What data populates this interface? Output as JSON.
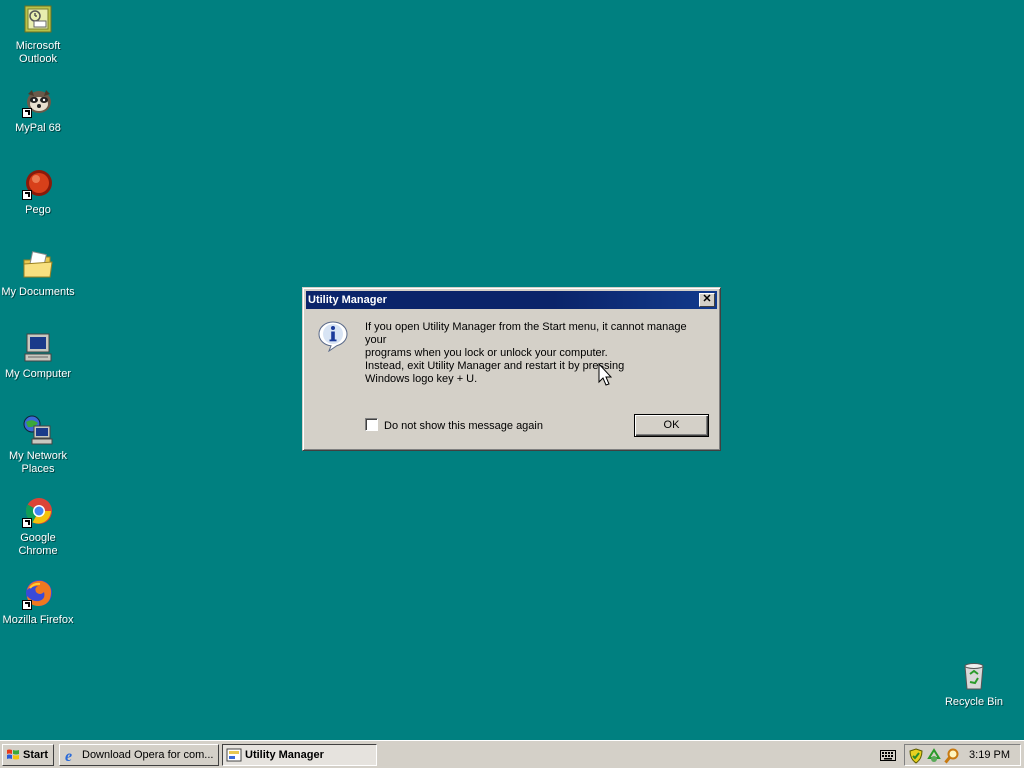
{
  "desktop": {
    "icons": [
      {
        "label_line1": "Microsoft",
        "label_line2": "Outlook",
        "icon": "outlook-icon"
      },
      {
        "label_line1": "MyPal 68",
        "label_line2": "",
        "icon": "mypal-icon"
      },
      {
        "label_line1": "Pego",
        "label_line2": "",
        "icon": "pego-icon"
      },
      {
        "label_line1": "My Documents",
        "label_line2": "",
        "icon": "folder-icon"
      },
      {
        "label_line1": "My Computer",
        "label_line2": "",
        "icon": "computer-icon"
      },
      {
        "label_line1": "My Network",
        "label_line2": "Places",
        "icon": "network-icon"
      },
      {
        "label_line1": "Google Chrome",
        "label_line2": "",
        "icon": "chrome-icon"
      },
      {
        "label_line1": "Mozilla Firefox",
        "label_line2": "",
        "icon": "firefox-icon"
      },
      {
        "label_line1": "Recycle Bin",
        "label_line2": "",
        "icon": "recycle-bin-icon"
      }
    ],
    "background_color": "#008080"
  },
  "dialog": {
    "title": "Utility Manager",
    "close_label": "✕",
    "message_line1": "If you open Utility Manager from the Start menu, it cannot manage your",
    "message_line2": "programs when you lock or unlock your computer.",
    "message_line3": "Instead, exit Utility Manager and restart it by pressing",
    "message_line4": "Windows logo key + U.",
    "checkbox_label": "Do not show this message again",
    "checkbox_checked": false,
    "ok_label": "OK"
  },
  "taskbar": {
    "start_label": "Start",
    "tasks": [
      {
        "label": "Download Opera for com...",
        "active": false
      },
      {
        "label": "Utility Manager",
        "active": true
      }
    ],
    "clock": "3:19 PM"
  }
}
